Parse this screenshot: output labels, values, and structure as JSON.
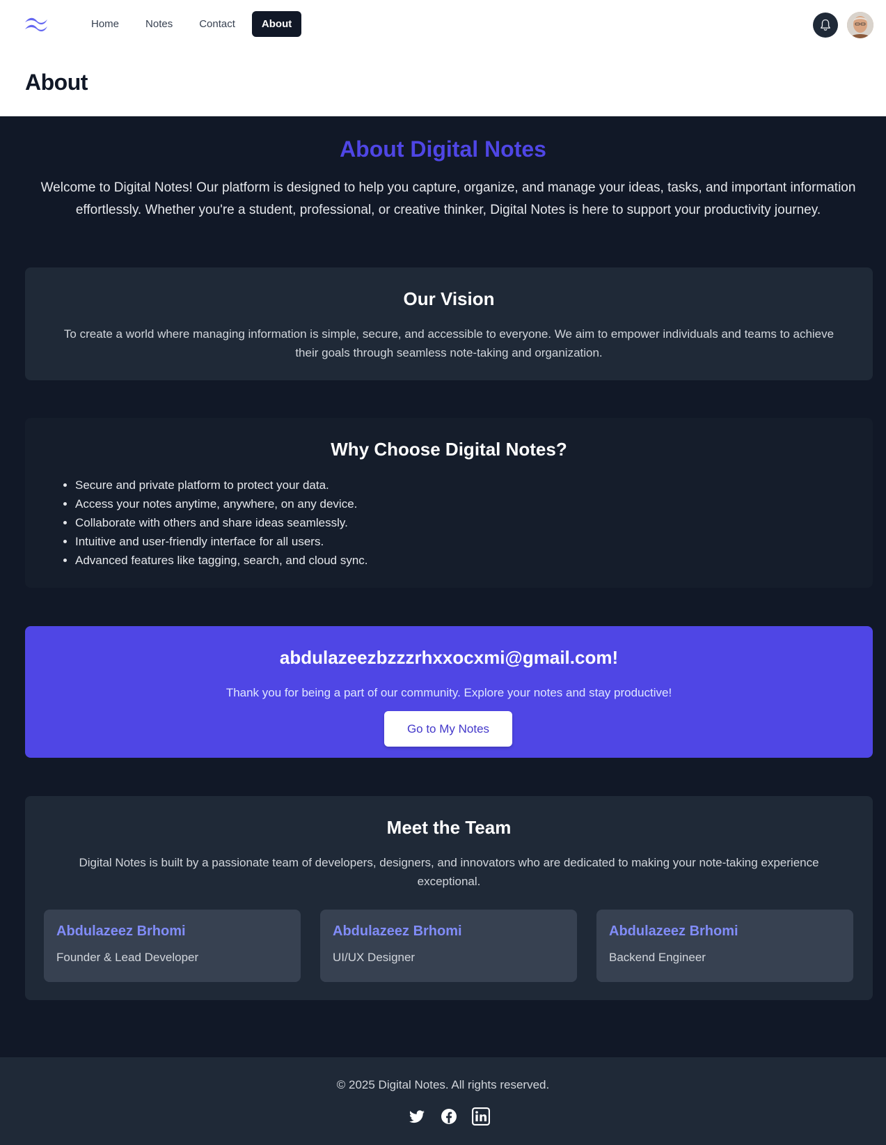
{
  "nav": {
    "items": [
      {
        "label": "Home"
      },
      {
        "label": "Notes"
      },
      {
        "label": "Contact"
      },
      {
        "label": "About"
      }
    ],
    "active": "About"
  },
  "page": {
    "title": "About"
  },
  "hero": {
    "title": "About Digital Notes",
    "text": "Welcome to Digital Notes! Our platform is designed to help you capture, organize, and manage your ideas, tasks, and important information effortlessly. Whether you're a student, professional, or creative thinker, Digital Notes is here to support your productivity journey."
  },
  "vision": {
    "title": "Our Vision",
    "text": "To create a world where managing information is simple, secure, and accessible to everyone. We aim to empower individuals and teams to achieve their goals through seamless note-taking and organization."
  },
  "why": {
    "title": "Why Choose Digital Notes?",
    "items": [
      "Secure and private platform to protect your data.",
      "Access your notes anytime, anywhere, on any device.",
      "Collaborate with others and share ideas seamlessly.",
      "Intuitive and user-friendly interface for all users.",
      "Advanced features like tagging, search, and cloud sync."
    ]
  },
  "welcome": {
    "title": "abdulazeezbzzzrhxxocxmi@gmail.com!",
    "text": "Thank you for being a part of our community. Explore your notes and stay productive!",
    "button": "Go to My Notes"
  },
  "team": {
    "title": "Meet the Team",
    "text": "Digital Notes is built by a passionate team of developers, designers, and innovators who are dedicated to making your note-taking experience exceptional.",
    "members": [
      {
        "name": "Abdulazeez Brhomi",
        "role": "Founder & Lead Developer"
      },
      {
        "name": "Abdulazeez Brhomi",
        "role": "UI/UX Designer"
      },
      {
        "name": "Abdulazeez Brhomi",
        "role": "Backend Engineer"
      }
    ]
  },
  "footer": {
    "copyright": "© 2025 Digital Notes. All rights reserved.",
    "social": [
      "twitter-icon",
      "facebook-icon",
      "linkedin-icon"
    ]
  },
  "colors": {
    "accent": "#4f46e5",
    "background": "#111827",
    "card": "#1f2937"
  }
}
